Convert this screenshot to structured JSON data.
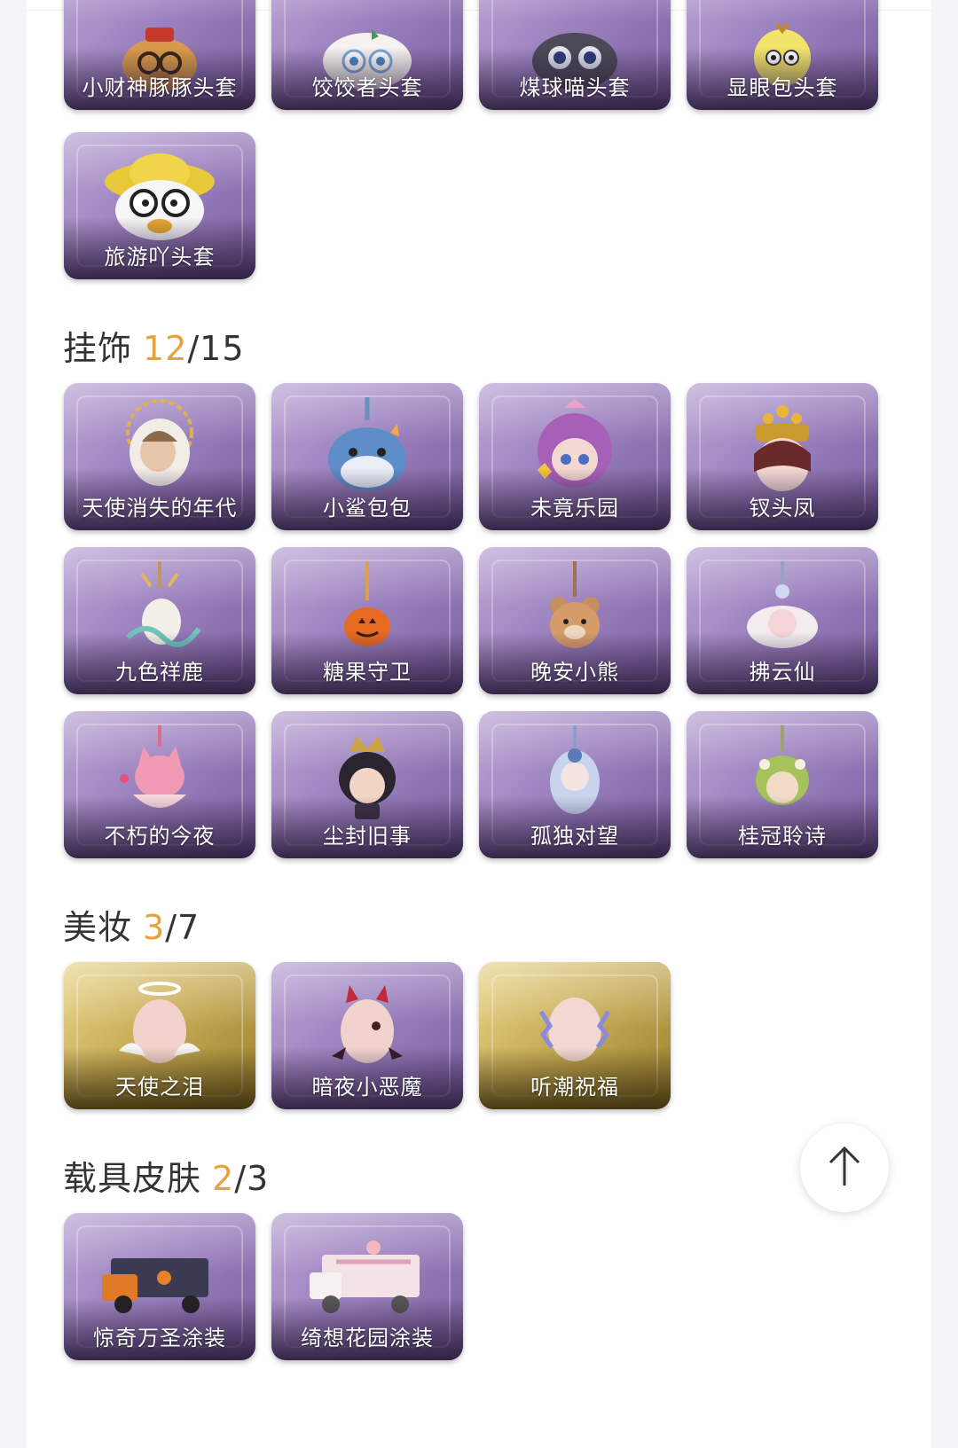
{
  "headwear": {
    "items": [
      {
        "label": "小财神豚豚头套",
        "icon": "pig-god-head-icon",
        "tone": "purple"
      },
      {
        "label": "饺饺者头套",
        "icon": "dumpling-head-icon",
        "tone": "purple"
      },
      {
        "label": "煤球喵头套",
        "icon": "black-cat-head-icon",
        "tone": "purple"
      },
      {
        "label": "显眼包头套",
        "icon": "bulb-head-icon",
        "tone": "purple"
      },
      {
        "label": "旅游吖头套",
        "icon": "duck-hat-head-icon",
        "tone": "purple"
      }
    ]
  },
  "pendants": {
    "title": "挂饰",
    "owned": "12",
    "total": "/15",
    "items": [
      {
        "label": "天使消失的年代",
        "icon": "angel-doll-icon",
        "tone": "purple"
      },
      {
        "label": "小鲨包包",
        "icon": "shark-pendant-icon",
        "tone": "purple"
      },
      {
        "label": "未竟乐园",
        "icon": "clown-doll-icon",
        "tone": "purple"
      },
      {
        "label": "钗头凤",
        "icon": "phoenix-crown-doll-icon",
        "tone": "purple"
      },
      {
        "label": "九色祥鹿",
        "icon": "deer-pendant-icon",
        "tone": "purple"
      },
      {
        "label": "糖果守卫",
        "icon": "pumpkin-pendant-icon",
        "tone": "purple"
      },
      {
        "label": "晚安小熊",
        "icon": "bear-pendant-icon",
        "tone": "purple"
      },
      {
        "label": "拂云仙",
        "icon": "cloud-fairy-pendant-icon",
        "tone": "purple"
      },
      {
        "label": "不朽的今夜",
        "icon": "pink-fox-pendant-icon",
        "tone": "purple"
      },
      {
        "label": "尘封旧事",
        "icon": "crowned-doll-icon",
        "tone": "purple"
      },
      {
        "label": "孤独对望",
        "icon": "blue-doll-pendant-icon",
        "tone": "purple"
      },
      {
        "label": "桂冠聆诗",
        "icon": "laurel-doll-pendant-icon",
        "tone": "purple"
      }
    ]
  },
  "makeup": {
    "title": "美妆",
    "owned": "3",
    "total": "/7",
    "items": [
      {
        "label": "天使之泪",
        "icon": "angel-face-icon",
        "tone": "gold"
      },
      {
        "label": "暗夜小恶魔",
        "icon": "devil-face-icon",
        "tone": "purple"
      },
      {
        "label": "听潮祝福",
        "icon": "wave-face-icon",
        "tone": "gold"
      }
    ]
  },
  "vehicle_skins": {
    "title": "载具皮肤",
    "owned": "2",
    "total": "/3",
    "items": [
      {
        "label": "惊奇万圣涂装",
        "icon": "halloween-truck-icon",
        "tone": "purple"
      },
      {
        "label": "绮想花园涂装",
        "icon": "garden-truck-icon",
        "tone": "purple"
      }
    ]
  },
  "colors": {
    "accent": "#e7a23c",
    "text": "#333333"
  },
  "scroll_top": {
    "icon": "arrow-up-icon"
  }
}
